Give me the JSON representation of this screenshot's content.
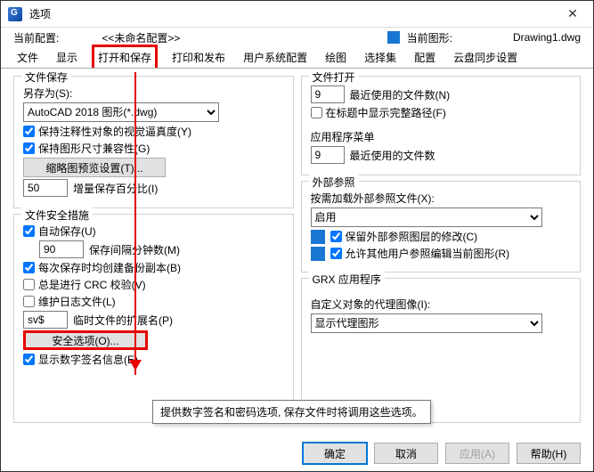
{
  "title": "选项",
  "config": {
    "curProfileLbl": "当前配置:",
    "curProfileVal": "<<未命名配置>>",
    "curDwgLbl": "当前图形:",
    "curDwgVal": "Drawing1.dwg"
  },
  "tabs": [
    "文件",
    "显示",
    "打开和保存",
    "打印和发布",
    "用户系统配置",
    "绘图",
    "选择集",
    "配置",
    "云盘同步设置"
  ],
  "left": {
    "fileSave": {
      "hdr": "文件保存",
      "saveAs": "另存为(S):",
      "format": "AutoCAD 2018 图形(*.dwg)",
      "annot": "保持注释性对象的视觉逼真度(Y)",
      "compat": "保持图形尺寸兼容性(G)",
      "thumbBtn": "缩略图预览设置(T)...",
      "incr": "50",
      "incrLbl": "增量保存百分比(I)"
    },
    "safety": {
      "hdr": "文件安全措施",
      "autoSave": "自动保存(U)",
      "interval": "90",
      "intervalLbl": "保存间隔分钟数(M)",
      "backup": "每次保存时均创建备份副本(B)",
      "crc": "总是进行 CRC 校验(V)",
      "log": "维护日志文件(L)",
      "tmpExt": "sv$",
      "tmpExtLbl": "临时文件的扩展名(P)",
      "secBtn": "安全选项(O)...",
      "sig": "显示数字签名信息(E)"
    }
  },
  "right": {
    "fileOpen": {
      "hdr": "文件打开",
      "recent": "9",
      "recentLbl": "最近使用的文件数(N)",
      "fullPath": "在标题中显示完整路径(F)"
    },
    "appMenu": {
      "hdr": "应用程序菜单",
      "recent": "9",
      "recentLbl": "最近使用的文件数"
    },
    "xref": {
      "hdr": "外部参照",
      "loadLbl": "按需加载外部参照文件(X):",
      "loadVal": "启用",
      "keepLayer": "保留外部参照图层的修改(C)",
      "allowEdit": "允许其他用户参照编辑当前图形(R)"
    },
    "grx": {
      "hdr": "GRX 应用程序",
      "proxyLbl": "自定义对象的代理图像(I):",
      "proxyVal": "显示代理图形"
    }
  },
  "footer": {
    "ok": "确定",
    "cancel": "取消",
    "apply": "应用(A)",
    "help": "帮助(H)"
  },
  "tooltip": "提供数字签名和密码选项, 保存文件时将调用这些选项。"
}
